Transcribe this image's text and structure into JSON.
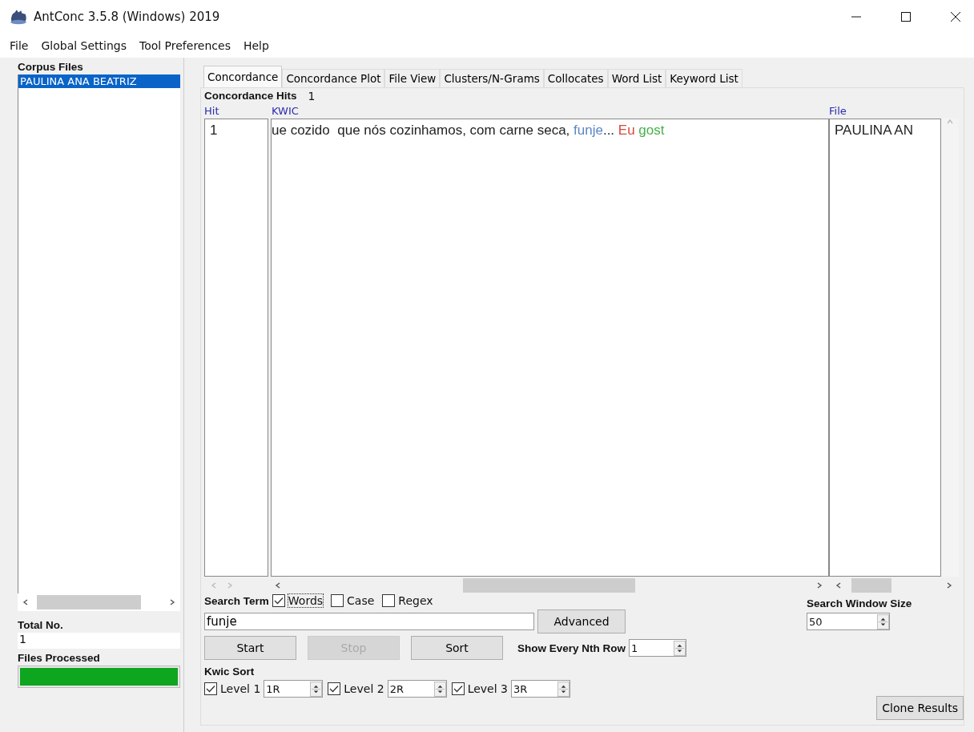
{
  "window": {
    "title": "AntConc 3.5.8 (Windows) 2019"
  },
  "menu": [
    "File",
    "Global Settings",
    "Tool Preferences",
    "Help"
  ],
  "corpus_files": {
    "title": "Corpus Files",
    "files": [
      {
        "name": "PAULINA ANA BEATRIZ",
        "selected": true
      }
    ]
  },
  "total": {
    "label": "Total No.",
    "value": "1"
  },
  "files_processed": {
    "label": "Files Processed",
    "level": 1
  },
  "tabs": [
    {
      "label": "Concordance",
      "selected": true
    },
    {
      "label": "Concordance Plot",
      "selected": false
    },
    {
      "label": "File View",
      "selected": false
    },
    {
      "label": "Clusters/N-Grams",
      "selected": false
    },
    {
      "label": "Collocates",
      "selected": false
    },
    {
      "label": "Word List",
      "selected": false
    },
    {
      "label": "Keyword List",
      "selected": false
    }
  ],
  "hits": {
    "label": "Concordance Hits",
    "value": "1"
  },
  "table": {
    "columns": [
      "Hit",
      "KWIC",
      "File"
    ],
    "rows": [
      {
        "hit": "1",
        "kwic": [
          {
            "text": "ue cozido  que nós cozinhamos, com carne seca, "
          },
          {
            "text": "funje",
            "color": "#5b86c6"
          },
          {
            "text": "... "
          },
          {
            "text": "Eu ",
            "color": "#d8483c"
          },
          {
            "text": "gost",
            "color": "#48b04a"
          }
        ],
        "file": "PAULINA AN"
      }
    ]
  },
  "search": {
    "label": "Search Term",
    "options": [
      {
        "label": "Words",
        "checked": true
      },
      {
        "label": "Case",
        "checked": false
      },
      {
        "label": "Regex",
        "checked": false
      }
    ],
    "value": "funje",
    "advanced": "Advanced"
  },
  "buttons": [
    {
      "label": "Start",
      "disabled": false
    },
    {
      "label": "Stop",
      "disabled": true
    },
    {
      "label": "Sort",
      "disabled": false
    }
  ],
  "nth_row": {
    "label": "Show Every Nth Row",
    "value": "1"
  },
  "window_size": {
    "label": "Search Window Size",
    "value": "50"
  },
  "kwic_sort": {
    "label": "Kwic Sort",
    "levels": [
      {
        "label": "Level 1",
        "checked": true,
        "value": "1R"
      },
      {
        "label": "Level 2",
        "checked": true,
        "value": "2R"
      },
      {
        "label": "Level 3",
        "checked": true,
        "value": "3R"
      }
    ]
  },
  "clone": "Clone Results"
}
